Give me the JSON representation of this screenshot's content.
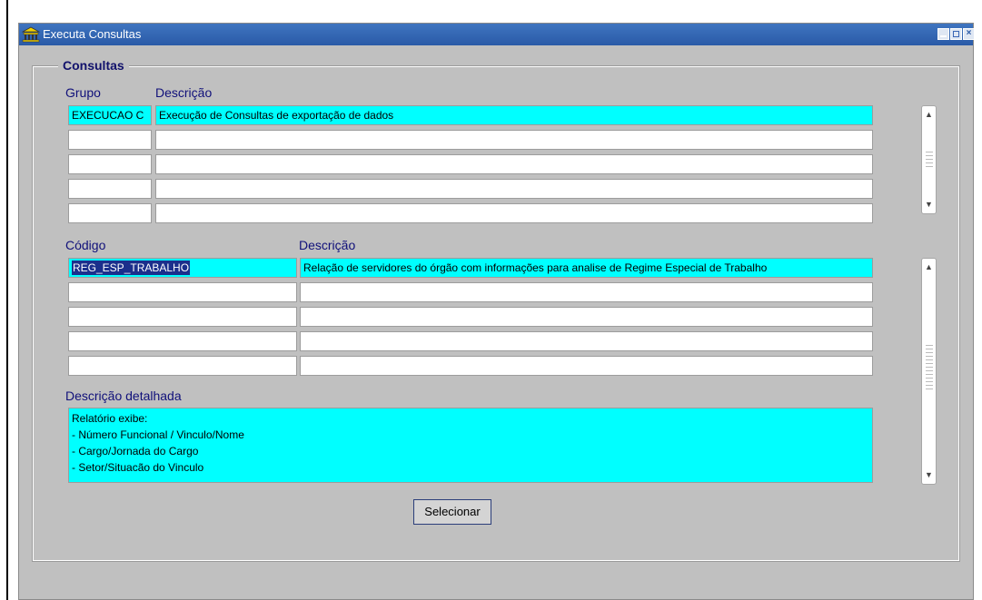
{
  "window": {
    "title": "Executa Consultas",
    "icon": "building-icon",
    "controls": [
      "minimize-icon",
      "maximize-icon",
      "close-icon"
    ]
  },
  "group": {
    "title": "Consultas"
  },
  "grupo_block": {
    "col_grupo": "Grupo",
    "col_descricao": "Descrição",
    "rows": [
      {
        "grupo": "EXECUCAO C",
        "descricao": "Execução de Consultas de exportação de dados"
      },
      {
        "grupo": "",
        "descricao": ""
      },
      {
        "grupo": "",
        "descricao": ""
      },
      {
        "grupo": "",
        "descricao": ""
      },
      {
        "grupo": "",
        "descricao": ""
      }
    ]
  },
  "codigo_block": {
    "col_codigo": "Código",
    "col_descricao": "Descrição",
    "rows": [
      {
        "codigo": "REG_ESP_TRABALHO",
        "descricao": "Relação de servidores do órgão com informações para analise de Regime Especial de Trabalho"
      },
      {
        "codigo": "",
        "descricao": ""
      },
      {
        "codigo": "",
        "descricao": ""
      },
      {
        "codigo": "",
        "descricao": ""
      },
      {
        "codigo": "",
        "descricao": ""
      }
    ]
  },
  "detalhe": {
    "label": "Descrição detalhada",
    "lines": [
      "Relatório exibe:",
      "- Número Funcional / Vinculo/Nome",
      "- Cargo/Jornada do Cargo",
      "- Setor/Situacão do Vinculo"
    ]
  },
  "buttons": {
    "selecionar": "Selecionar"
  },
  "colors": {
    "title_bar": "#2a5aa7",
    "highlight": "#00ffff",
    "label": "#10107a",
    "background": "#c0c0c0"
  }
}
